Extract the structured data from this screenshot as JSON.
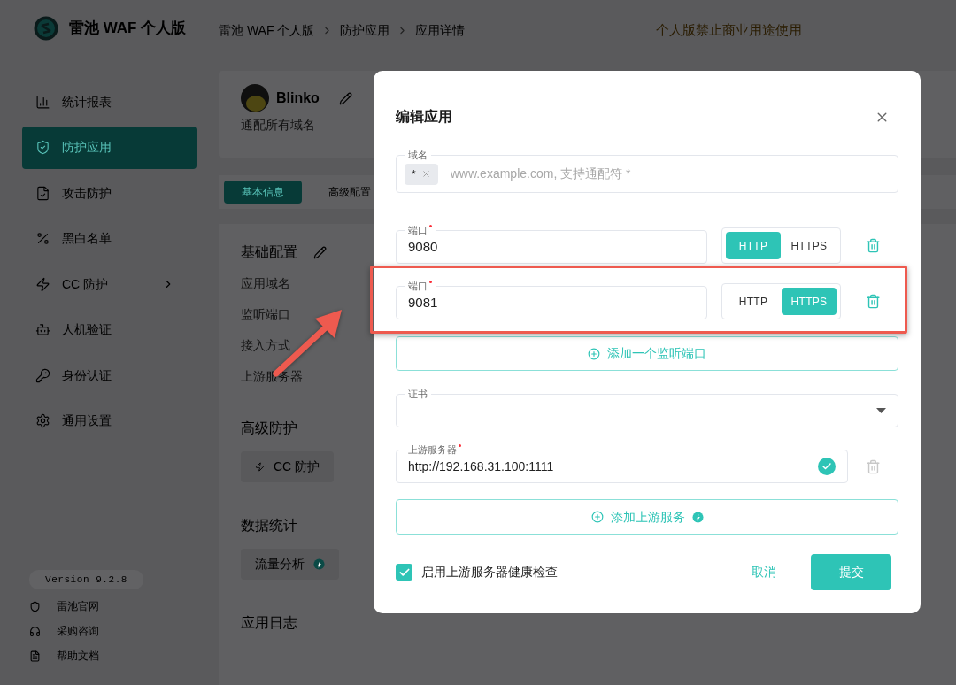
{
  "app": {
    "logo_text": "雷池 WAF 个人版",
    "notice": "个人版禁止商业用途使用"
  },
  "breadcrumb": [
    "雷池 WAF 个人版",
    "防护应用",
    "应用详情"
  ],
  "sidebar": {
    "items": [
      {
        "label": "统计报表",
        "selected": false,
        "has_submenu": false
      },
      {
        "label": "防护应用",
        "selected": true,
        "has_submenu": false
      },
      {
        "label": "攻击防护",
        "selected": false,
        "has_submenu": false
      },
      {
        "label": "黑白名单",
        "selected": false,
        "has_submenu": false
      },
      {
        "label": "CC 防护",
        "selected": false,
        "has_submenu": true
      },
      {
        "label": "人机验证",
        "selected": false,
        "has_submenu": false
      },
      {
        "label": "身份认证",
        "selected": false,
        "has_submenu": false
      },
      {
        "label": "通用设置",
        "selected": false,
        "has_submenu": false
      }
    ],
    "version": "Version 9.2.8",
    "links": [
      "雷池官网",
      "采购咨询",
      "帮助文档"
    ]
  },
  "app_card": {
    "name": "Blinko",
    "subtitle": "通配所有域名"
  },
  "tabs": [
    {
      "label": "基本信息",
      "selected": true
    },
    {
      "label": "高级配置",
      "selected": false
    }
  ],
  "basic": {
    "title": "基础配置",
    "fields": [
      "应用域名",
      "监听端口",
      "接入方式",
      "上游服务器"
    ]
  },
  "sections": [
    {
      "title": "高级防护",
      "chips": [
        {
          "label": "CC 防护",
          "kind": "cc"
        }
      ]
    },
    {
      "title": "数据统计",
      "chips": [
        {
          "label": "流量分析",
          "kind": "pro"
        }
      ]
    },
    {
      "title": "应用日志"
    }
  ],
  "dialog": {
    "title": "编辑应用",
    "domain": {
      "label": "域名",
      "tags": [
        "*"
      ],
      "placeholder": "www.example.com, 支持通配符 *"
    },
    "ports": [
      {
        "label": "端口",
        "required": true,
        "value": "9080",
        "highlighted": false,
        "protocols": [
          {
            "label": "HTTP",
            "selected": true
          },
          {
            "label": "HTTPS",
            "selected": false
          }
        ]
      },
      {
        "label": "端口",
        "required": true,
        "value": "9081",
        "highlighted": true,
        "protocols": [
          {
            "label": "HTTP",
            "selected": false
          },
          {
            "label": "HTTPS",
            "selected": true
          }
        ]
      }
    ],
    "add_port": "添加一个监听端口",
    "cert": {
      "label": "证书"
    },
    "upstreams": [
      {
        "label": "上游服务器",
        "required": true,
        "value": "http://192.168.31.100:1111",
        "valid": true,
        "removable": false
      }
    ],
    "add_upstream": "添加上游服务",
    "health_check": {
      "label": "启用上游服务器健康检查",
      "checked": true
    },
    "cancel": "取消",
    "submit": "提交"
  }
}
